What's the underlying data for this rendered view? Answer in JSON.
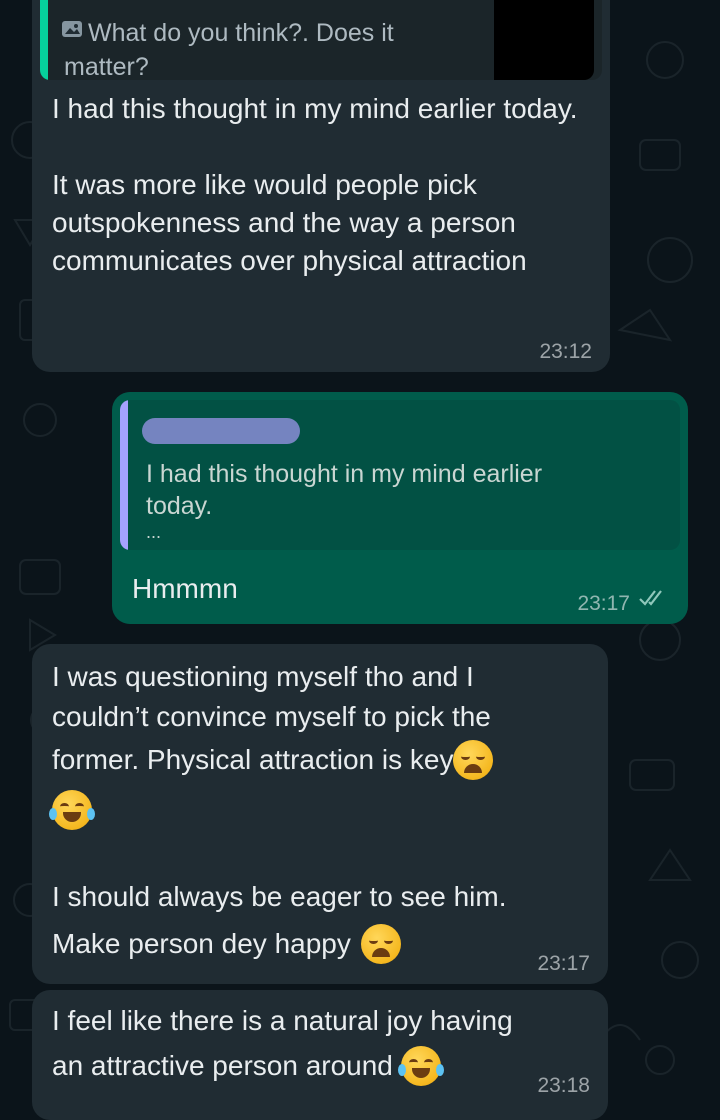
{
  "messages": [
    {
      "quote_text": "What do you think?. Does it matter?",
      "text": "I had this thought in my mind earlier today.\n\nIt was more like would people pick outspokenness and the way a person communicates over physical attraction",
      "time": "23:12"
    },
    {
      "quote_text": "I had this thought in my mind earlier today.",
      "quote_more": "...",
      "text": "Hmmmn",
      "time": "23:17"
    },
    {
      "line1": "I was questioning myself tho and I",
      "line2": "couldn’t convince myself to pick the",
      "line3": "former. Physical attraction is key",
      "line4": "I should always be eager to see him.",
      "line5": "Make person dey happy",
      "time": "23:17"
    },
    {
      "line1": "I feel like there is a natural joy having",
      "line2": "an attractive person around",
      "time": "23:18"
    }
  ],
  "emojis": [
    "weary-face",
    "face-with-tears-of-joy",
    "weary-face",
    "face-with-tears-of-joy"
  ],
  "colors": {
    "background": "#0b141a",
    "incoming_bubble": "#202c33",
    "outgoing_bubble": "#005c4b",
    "quote_bar_in": "#06cf9c",
    "quote_bar_out": "#a5a2ff"
  }
}
